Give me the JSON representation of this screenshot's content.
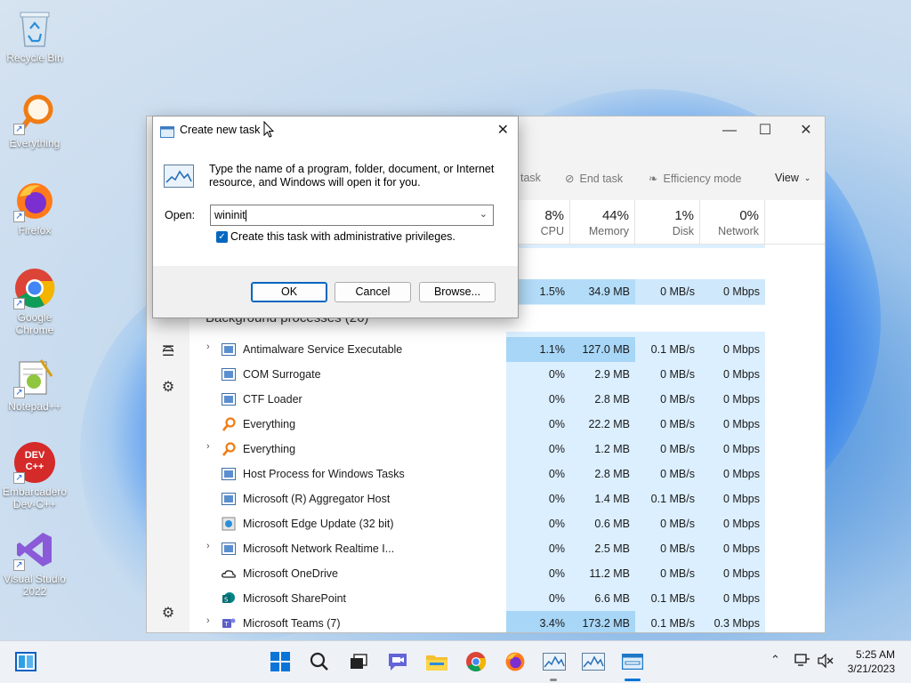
{
  "desktop": {
    "icons": [
      {
        "label": "Recycle Bin"
      },
      {
        "label": "Everything"
      },
      {
        "label": "Firefox"
      },
      {
        "label": "Google Chrome"
      },
      {
        "label": "Notepad++"
      },
      {
        "label": "Embarcadero Dev-C++"
      },
      {
        "label": "Visual Studio 2022"
      }
    ],
    "devcpp_logo": "DEV C++"
  },
  "task_manager": {
    "toolbar": {
      "run_task": "task",
      "end_task": "End task",
      "efficiency": "Efficiency mode",
      "view": "View"
    },
    "columns": {
      "cpu": {
        "pct": "8%",
        "label": "CPU"
      },
      "memory": {
        "pct": "44%",
        "label": "Memory"
      },
      "disk": {
        "pct": "1%",
        "label": "Disk"
      },
      "network": {
        "pct": "0%",
        "label": "Network"
      }
    },
    "app_row": {
      "cpu": "1.5%",
      "memory": "34.9 MB",
      "disk": "0 MB/s",
      "network": "0 Mbps"
    },
    "section_title": "Background processes (26)",
    "processes": [
      {
        "name": "Antimalware Service Executable",
        "cpu": "1.1%",
        "memory": "127.0 MB",
        "disk": "0.1 MB/s",
        "network": "0 Mbps"
      },
      {
        "name": "COM Surrogate",
        "cpu": "0%",
        "memory": "2.9 MB",
        "disk": "0 MB/s",
        "network": "0 Mbps"
      },
      {
        "name": "CTF Loader",
        "cpu": "0%",
        "memory": "2.8 MB",
        "disk": "0 MB/s",
        "network": "0 Mbps"
      },
      {
        "name": "Everything",
        "cpu": "0%",
        "memory": "22.2 MB",
        "disk": "0 MB/s",
        "network": "0 Mbps"
      },
      {
        "name": "Everything",
        "cpu": "0%",
        "memory": "1.2 MB",
        "disk": "0 MB/s",
        "network": "0 Mbps"
      },
      {
        "name": "Host Process for Windows Tasks",
        "cpu": "0%",
        "memory": "2.8 MB",
        "disk": "0 MB/s",
        "network": "0 Mbps"
      },
      {
        "name": "Microsoft (R) Aggregator Host",
        "cpu": "0%",
        "memory": "1.4 MB",
        "disk": "0.1 MB/s",
        "network": "0 Mbps"
      },
      {
        "name": "Microsoft Edge Update (32 bit)",
        "cpu": "0%",
        "memory": "0.6 MB",
        "disk": "0 MB/s",
        "network": "0 Mbps"
      },
      {
        "name": "Microsoft Network Realtime I...",
        "cpu": "0%",
        "memory": "2.5 MB",
        "disk": "0 MB/s",
        "network": "0 Mbps"
      },
      {
        "name": "Microsoft OneDrive",
        "cpu": "0%",
        "memory": "11.2 MB",
        "disk": "0 MB/s",
        "network": "0 Mbps"
      },
      {
        "name": "Microsoft SharePoint",
        "cpu": "0%",
        "memory": "6.6 MB",
        "disk": "0.1 MB/s",
        "network": "0 Mbps"
      },
      {
        "name": "Microsoft Teams (7)",
        "cpu": "3.4%",
        "memory": "173.2 MB",
        "disk": "0.1 MB/s",
        "network": "0.3 Mbps"
      }
    ]
  },
  "dialog": {
    "title": "Create new task",
    "description": "Type the name of a program, folder, document, or Internet resource, and Windows will open it for you.",
    "open_label": "Open:",
    "open_value": "wininit",
    "admin_label": "Create this task with administrative privileges.",
    "ok": "OK",
    "cancel": "Cancel",
    "browse": "Browse..."
  },
  "taskbar": {
    "time": "5:25 AM",
    "date": "3/21/2023"
  },
  "colors": {
    "accent": "#0067c0",
    "heat_light": "#cfe8fb",
    "heat_medium": "#a8d6f7"
  }
}
